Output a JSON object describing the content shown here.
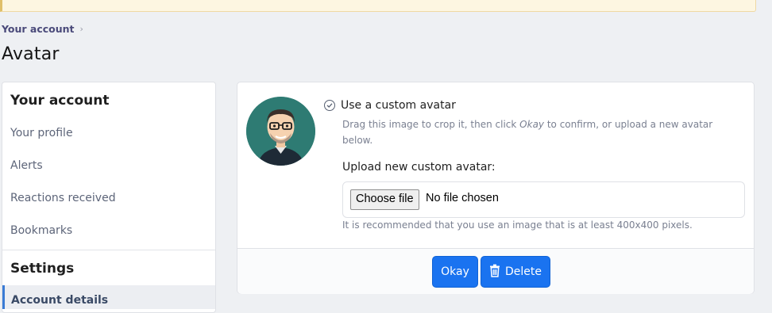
{
  "breadcrumb": {
    "item": "Your account",
    "separator": "›"
  },
  "page_title": "Avatar",
  "sidebar": {
    "section1_title": "Your account",
    "items": [
      {
        "label": "Your profile"
      },
      {
        "label": "Alerts"
      },
      {
        "label": "Reactions received"
      },
      {
        "label": "Bookmarks"
      }
    ],
    "section2_title": "Settings",
    "active_item": "Account details"
  },
  "panel": {
    "option_label": "Use a custom avatar",
    "hint_prefix": "Drag this image to crop it, then click ",
    "hint_em": "Okay",
    "hint_suffix": " to confirm, or upload a new avatar below.",
    "upload_label": "Upload new custom avatar:",
    "file_button": "Choose file",
    "file_status": "No file chosen",
    "file_explain": "It is recommended that you use an image that is at least 400x400 pixels."
  },
  "actions": {
    "okay": "Okay",
    "delete": "Delete"
  },
  "colors": {
    "accent": "#1a73f0",
    "avatar_bg": "#2e7b73",
    "notice_bg": "#fdf6e1"
  }
}
